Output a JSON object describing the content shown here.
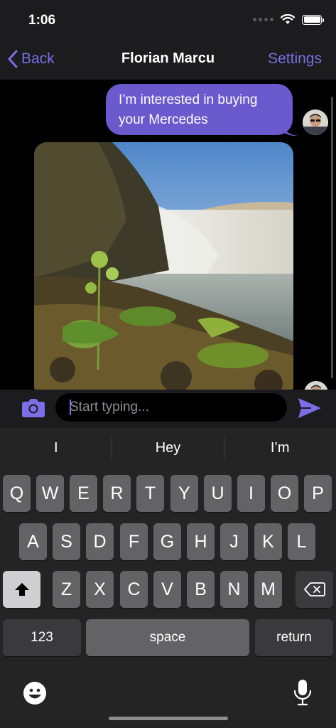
{
  "status": {
    "time": "1:06"
  },
  "nav": {
    "back_label": "Back",
    "title": "Florian Marcu",
    "settings_label": "Settings"
  },
  "messages": [
    {
      "type": "text",
      "direction": "outgoing",
      "text": "I’m interested in buying your Mercedes"
    },
    {
      "type": "image",
      "direction": "outgoing",
      "description": ""
    }
  ],
  "input": {
    "placeholder": "Start typing...",
    "value": ""
  },
  "keyboard": {
    "suggestions": [
      "I",
      "Hey",
      "I’m"
    ],
    "row1": [
      "Q",
      "W",
      "E",
      "R",
      "T",
      "Y",
      "U",
      "I",
      "O",
      "P"
    ],
    "row2": [
      "A",
      "S",
      "D",
      "F",
      "G",
      "H",
      "J",
      "K",
      "L"
    ],
    "row3": [
      "Z",
      "X",
      "C",
      "V",
      "B",
      "N",
      "M"
    ],
    "numbers_label": "123",
    "space_label": "space",
    "return_label": "return"
  },
  "colors": {
    "accent": "#7c6ee6",
    "bubble": "#6a5acd",
    "keyboard_bg": "#242424",
    "key_bg": "#636366"
  },
  "icons": [
    "back-chevron-icon",
    "camera-icon",
    "send-icon",
    "shift-icon",
    "delete-icon",
    "emoji-icon",
    "microphone-icon",
    "wifi-icon",
    "battery-icon"
  ]
}
